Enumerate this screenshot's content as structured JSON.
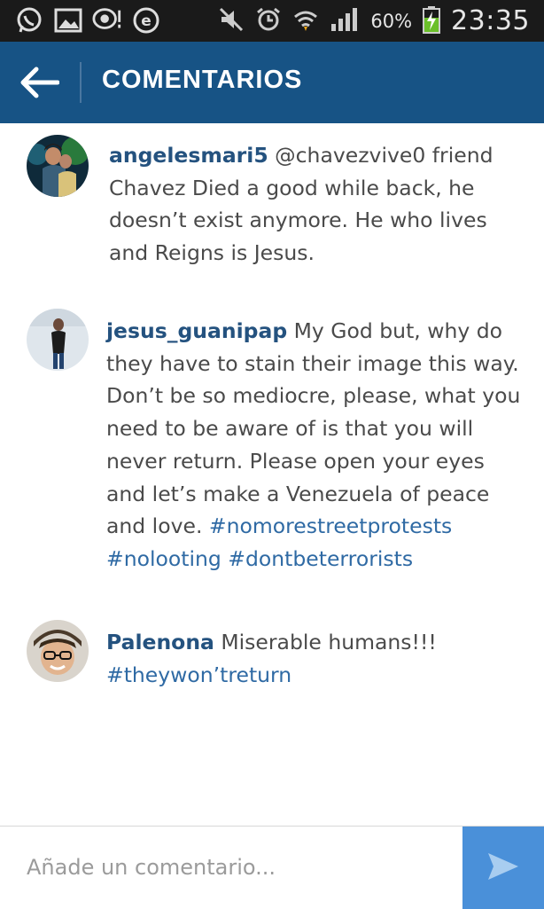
{
  "statusbar": {
    "battery": "60%",
    "time": "23:35"
  },
  "appbar": {
    "title": "COMENTARIOS"
  },
  "comments": [
    {
      "user": "angelesmari5",
      "text": " @chavezvive0 friend Chavez Died a good while back, he doesn’t exist anymore. He who lives and Reigns is Jesus."
    },
    {
      "user": "jesus_guanipap",
      "text": " My God but, why do they have to stain their image this way. Don’t be so mediocre, please, what you need to be aware of is that you will never return. Please open your eyes and let’s make a Venezuela of peace and love. ",
      "tags": [
        "#nomorestreetprotests",
        "#nolooting",
        "#dontbeterrorists"
      ]
    },
    {
      "user": "Palenona",
      "text": " Miserable humans!!!",
      "tags": [
        "#theywon’treturn"
      ]
    }
  ],
  "composer": {
    "placeholder": "Añade un comentario..."
  },
  "icons": {
    "whatsapp": "whatsapp-icon",
    "gallery": "gallery-icon",
    "chat": "chat-bubble-icon",
    "evernote": "e-icon",
    "mute": "mute-icon",
    "alarm": "alarm-icon",
    "wifi": "wifi-icon",
    "signal": "signal-icon",
    "battery": "battery-charging-icon",
    "back": "back-arrow-icon",
    "send": "send-icon"
  },
  "colors": {
    "appbar": "#175385",
    "username": "#24527f",
    "hashtag": "#2f6aa4",
    "send": "#4a90d9"
  }
}
